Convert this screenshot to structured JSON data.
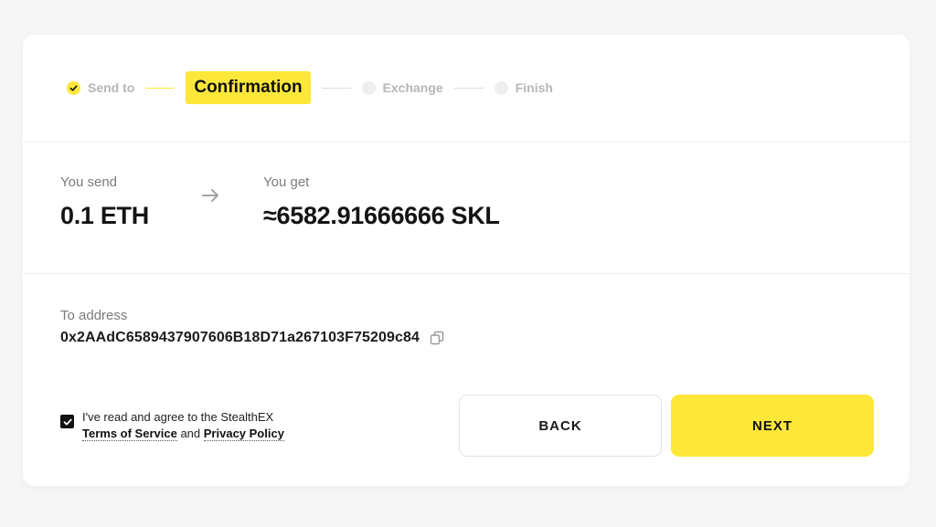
{
  "stepper": {
    "steps": [
      {
        "label": "Send to",
        "state": "done"
      },
      {
        "label": "Confirmation",
        "state": "active"
      },
      {
        "label": "Exchange",
        "state": "pending"
      },
      {
        "label": "Finish",
        "state": "pending"
      }
    ]
  },
  "summary": {
    "send_label": "You send",
    "send_amount": "0.1 ETH",
    "get_label": "You get",
    "get_amount": "≈6582.91666666 SKL",
    "arrow_icon": "arrow-right-icon"
  },
  "address": {
    "label": "To address",
    "value": "0x2AAdC6589437907606B18D71a267103F75209c84",
    "copy_icon": "copy-icon"
  },
  "agreement": {
    "checked": true,
    "text_before": "I've read and agree to the StealthEX",
    "terms_link": "Terms of Service",
    "and_text": "and",
    "privacy_link": "Privacy Policy"
  },
  "buttons": {
    "back_label": "BACK",
    "next_label": "NEXT"
  },
  "colors": {
    "accent": "#fde83a",
    "background": "#f6f6f6",
    "card": "#ffffff",
    "muted_text": "#b7b7b7"
  }
}
